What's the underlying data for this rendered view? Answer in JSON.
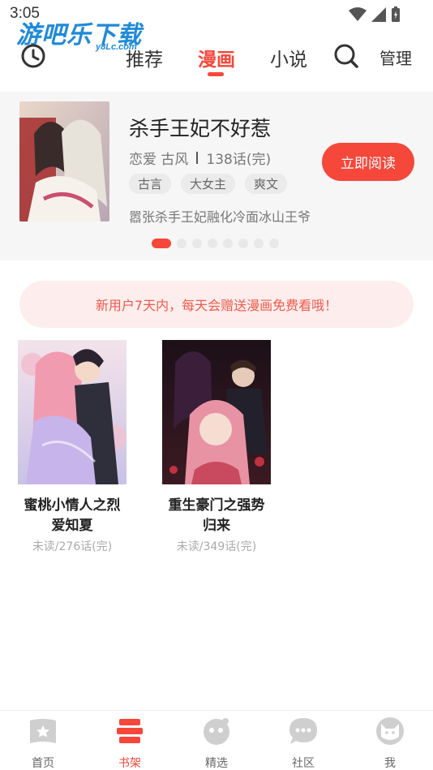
{
  "status_bar": {
    "time": "3:05"
  },
  "watermark": {
    "text": "游吧乐下载",
    "sub": "y8Lc.com"
  },
  "top_nav": {
    "tabs": [
      {
        "label": "推荐",
        "active": false
      },
      {
        "label": "漫画",
        "active": true
      },
      {
        "label": "小说",
        "active": false
      }
    ],
    "manage_label": "管理",
    "history_icon": "clock-icon",
    "search_icon": "search-icon"
  },
  "featured": {
    "title": "杀手王妃不好惹",
    "genres": "恋爱 古风",
    "episodes": "138话(完)",
    "tags": [
      "古言",
      "大女主",
      "爽文"
    ],
    "description": "嚣张杀手王妃融化冷面冰山王爷",
    "read_button": "立即阅读",
    "carousel_total": 8,
    "carousel_active": 1
  },
  "promo": {
    "text": "新用户7天内，每天会赠送漫画免费看哦！"
  },
  "shelf": {
    "books": [
      {
        "title": "蜜桃小情人之烈爱知夏",
        "progress": "未读/276话(完)"
      },
      {
        "title": "重生豪门之强势归来",
        "progress": "未读/349话(完)"
      }
    ]
  },
  "bottom_nav": {
    "items": [
      {
        "label": "首页",
        "icon": "home-icon",
        "active": false
      },
      {
        "label": "书架",
        "icon": "bookshelf-icon",
        "active": true
      },
      {
        "label": "精选",
        "icon": "featured-icon",
        "active": false
      },
      {
        "label": "社区",
        "icon": "community-icon",
        "active": false
      },
      {
        "label": "我",
        "icon": "profile-icon",
        "active": false
      }
    ]
  },
  "colors": {
    "accent": "#f5473a",
    "promo_bg": "#fdeeed",
    "icon_gray": "#cfcfcf"
  }
}
